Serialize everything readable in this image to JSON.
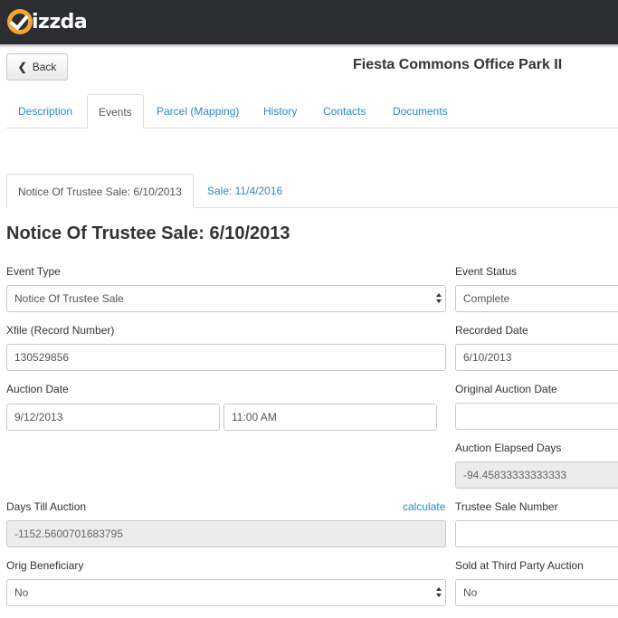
{
  "app": {
    "logo_text": "izzda"
  },
  "header": {
    "back_label": "Back",
    "property_title": "Fiesta Commons Office Park II"
  },
  "tabs": [
    {
      "label": "Description"
    },
    {
      "label": "Events"
    },
    {
      "label": "Parcel (Mapping)"
    },
    {
      "label": "History"
    },
    {
      "label": "Contacts"
    },
    {
      "label": "Documents"
    }
  ],
  "active_tab": "Events",
  "event_tabs": [
    {
      "label": "Notice Of Trustee Sale: 6/10/2013"
    },
    {
      "label": "Sale: 11/4/2016"
    }
  ],
  "event": {
    "heading": "Notice Of Trustee Sale: 6/10/2013",
    "event_type": {
      "label": "Event Type",
      "value": "Notice Of Trustee Sale"
    },
    "event_status": {
      "label": "Event Status",
      "value": "Complete"
    },
    "xfile": {
      "label": "Xfile (Record Number)",
      "value": "130529856"
    },
    "recorded_date": {
      "label": "Recorded Date",
      "value": "6/10/2013"
    },
    "auction_date": {
      "label": "Auction Date",
      "date": "9/12/2013",
      "time": "11:00 AM"
    },
    "original_auction_date": {
      "label": "Original Auction Date",
      "value": ""
    },
    "auction_elapsed_days": {
      "label": "Auction Elapsed Days",
      "value": "-94.45833333333333"
    },
    "days_till_auction": {
      "label": "Days Till Auction",
      "value": "-1152.5600701683795",
      "action": "calculate"
    },
    "trustee_sale_number": {
      "label": "Trustee Sale Number",
      "value": ""
    },
    "orig_beneficiary": {
      "label": "Orig Beneficiary",
      "value": "No"
    },
    "sold_third_party": {
      "label": "Sold at Third Party Auction",
      "value": "No"
    }
  },
  "colors": {
    "topbar": "#2b2d31",
    "logo_accent": "#f3a535",
    "link": "#2a8ac9"
  }
}
